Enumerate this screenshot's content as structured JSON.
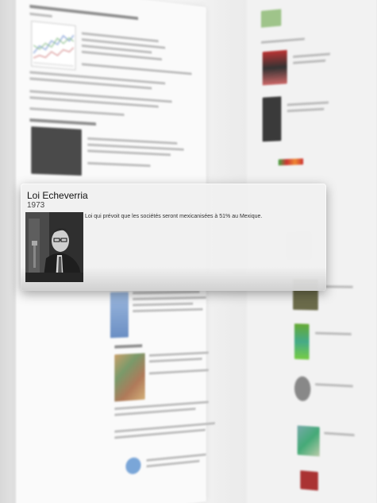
{
  "popup": {
    "title": "Loi Echeverria",
    "year": "1973",
    "description": "Loi qui prévoit que les sociétés seront mexicanisées à 51% au Mexique."
  }
}
